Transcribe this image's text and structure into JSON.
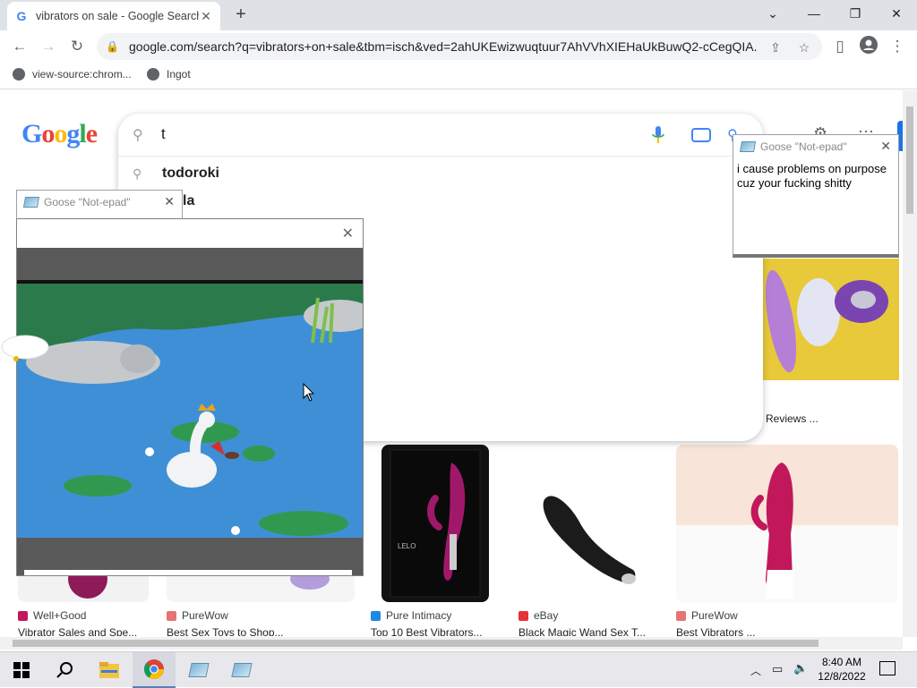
{
  "browser": {
    "tab_title": "vibrators on sale - Google Search",
    "tab_close": "✕",
    "new_tab": "+",
    "url": "google.com/search?q=vibrators+on+sale&tbm=isch&ved=2ahUKEwizwuqtuur7AhVVhXIEHaUkBuwQ2-cCegQIA...",
    "bookmarks": [
      {
        "label": "view-source:chrom..."
      },
      {
        "label": "Ingot"
      }
    ]
  },
  "logo_letters": [
    {
      "ch": "G",
      "color": "#4285f4"
    },
    {
      "ch": "o",
      "color": "#ea4335"
    },
    {
      "ch": "o",
      "color": "#fbbc05"
    },
    {
      "ch": "g",
      "color": "#4285f4"
    },
    {
      "ch": "l",
      "color": "#34a853"
    },
    {
      "ch": "e",
      "color": "#ea4335"
    }
  ],
  "search": {
    "query": "t",
    "suggestions": [
      {
        "text": "todoroki"
      },
      {
        "text": "la"
      }
    ]
  },
  "notepad_right": {
    "title": "Goose \"Not-epad\"",
    "body": "i cause problems on purpose cuz your fucking shitty"
  },
  "notepad_left": {
    "title": "Goose \"Not-epad\""
  },
  "results": [
    {
      "source": "Well+Good",
      "title": "Vibrator Sales and Spe...",
      "fav_color": "#c2185b",
      "thumb_color": "#f2f2f2"
    },
    {
      "source": "PureWow",
      "title": "Best Sex Toys to Shop...",
      "fav_color": "#e57373",
      "thumb_color": "#f5f5f5"
    },
    {
      "source": "Pure Intimacy",
      "title": "Top 10 Best Vibrators...",
      "fav_color": "#1e88e5",
      "thumb_color": "#111111"
    },
    {
      "source": "eBay",
      "title": "Black Magic Wand Sex T...",
      "fav_color": "#e53238",
      "thumb_color": "#ffffff"
    },
    {
      "source": "PureWow",
      "title": "Best Vibrators ...",
      "fav_color": "#e57373",
      "thumb_color": "#f8e4d8"
    }
  ],
  "partial_result": {
    "title": "Reviews ..."
  },
  "product_brand": "LELO",
  "taskbar": {
    "time": "8:40 AM",
    "date": "12/8/2022"
  }
}
